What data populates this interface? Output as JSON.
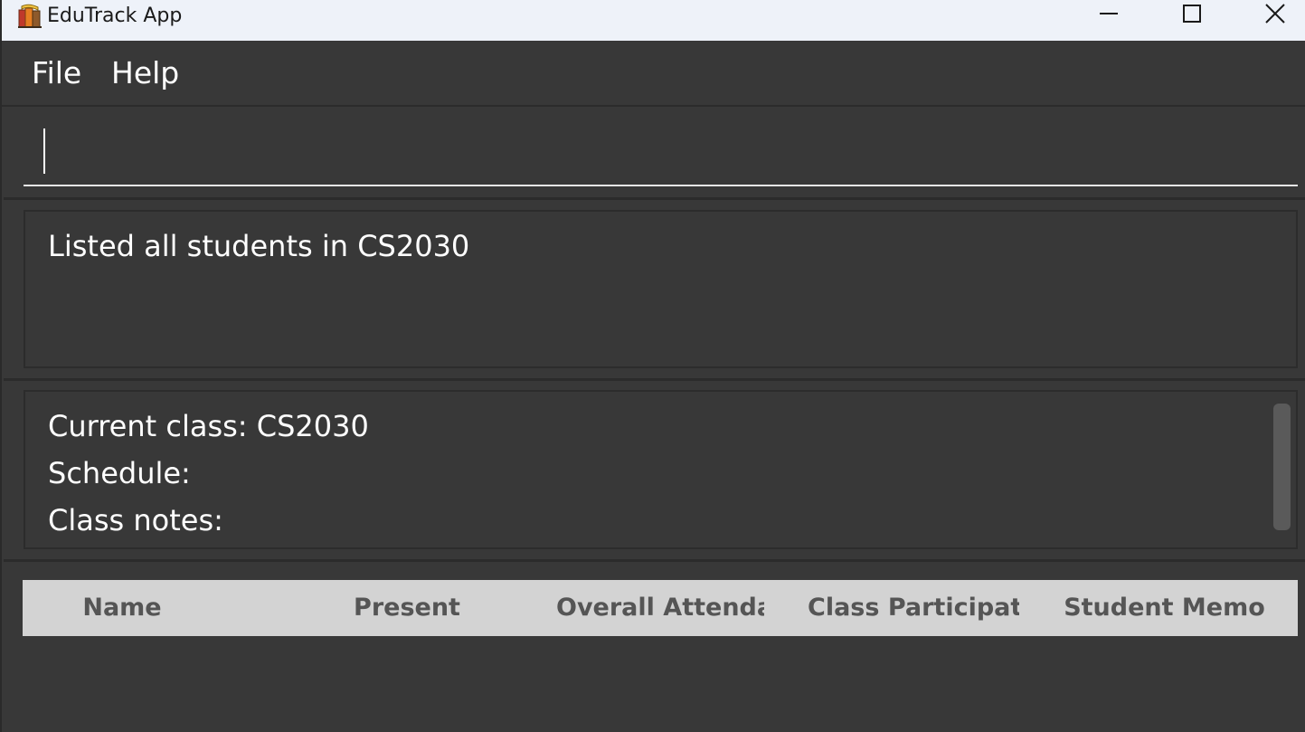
{
  "window": {
    "title": "EduTrack App",
    "app_icon": "books-icon"
  },
  "menu": {
    "file_label": "File",
    "help_label": "Help"
  },
  "command": {
    "value": "",
    "placeholder": ""
  },
  "result": {
    "message": "Listed all students in CS2030"
  },
  "class_info": {
    "current_class_label": "Current class: CS2030",
    "schedule_label": "Schedule:",
    "class_notes_label": "Class notes:"
  },
  "table": {
    "columns": [
      "Name",
      "Present",
      "Overall Attenda...",
      "Class Participati...",
      "Student Memo"
    ],
    "rows": []
  },
  "colors": {
    "background": "#383838",
    "titlebar": "#eef2f9",
    "header_bg": "#d3d3d3",
    "header_text": "#555555",
    "text": "#ffffff"
  }
}
